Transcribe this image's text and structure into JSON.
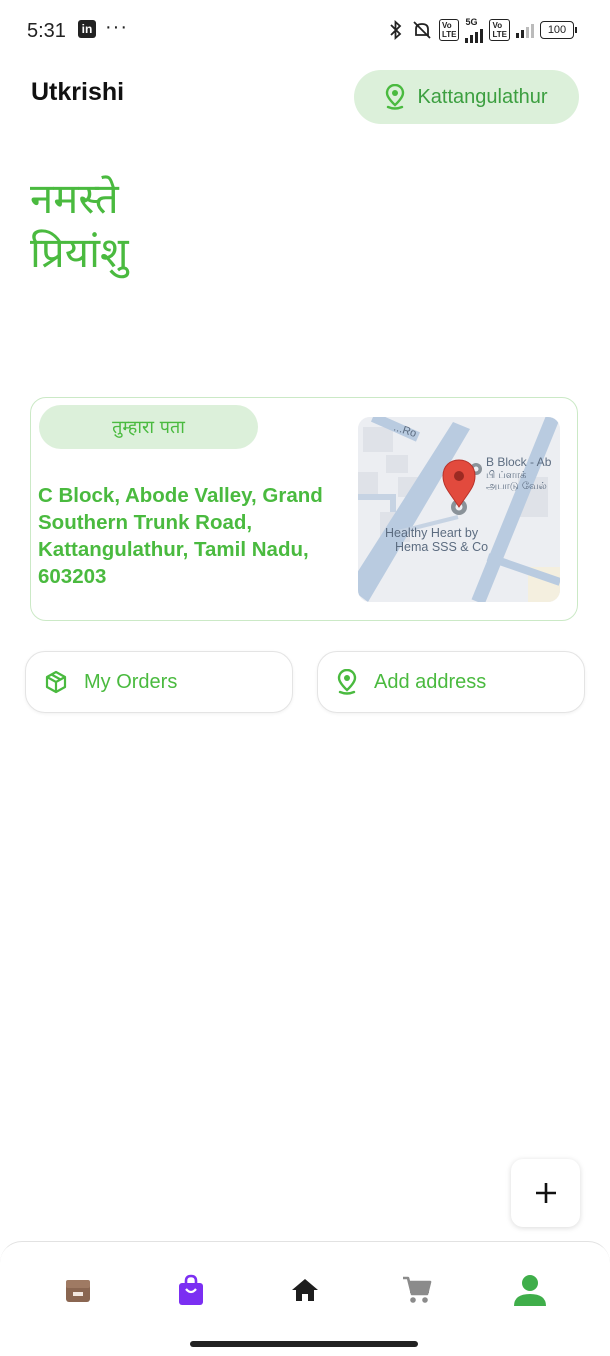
{
  "status_bar": {
    "time": "5:31",
    "app_badge": "in",
    "more": "···",
    "network": "5G",
    "volte": "Vo LTE",
    "battery": "100"
  },
  "header": {
    "title": "Utkrishi",
    "location": "Kattangulathur"
  },
  "greeting": {
    "line1": "नमस्ते",
    "line2": "प्रियांशु"
  },
  "address_card": {
    "tag": "तुम्हारा पता",
    "address": "C Block, Abode Valley, Grand Southern Trunk Road, Kattangulathur, Tamil Nadu, 603203",
    "map": {
      "road_label": "...Ro",
      "place1_line1": "B Block - Ab",
      "place1_line2": "பி ப்ளாக்",
      "place1_line3": "அபாடு வேல்",
      "place2_line1": "Healthy Heart by",
      "place2_line2": "Hema SSS & Co"
    }
  },
  "actions": {
    "orders": "My Orders",
    "add_address": "Add address"
  },
  "fab": {
    "icon": "plus-icon"
  },
  "nav": {
    "items": [
      "store-icon",
      "shopping-bag-icon",
      "home-icon",
      "cart-icon",
      "profile-icon"
    ],
    "active": "profile-icon"
  },
  "colors": {
    "accent_green": "#4aba3f",
    "chip_bg": "#dcf0da",
    "bag_purple": "#7b2ff2",
    "store_brown": "#8a6651"
  }
}
